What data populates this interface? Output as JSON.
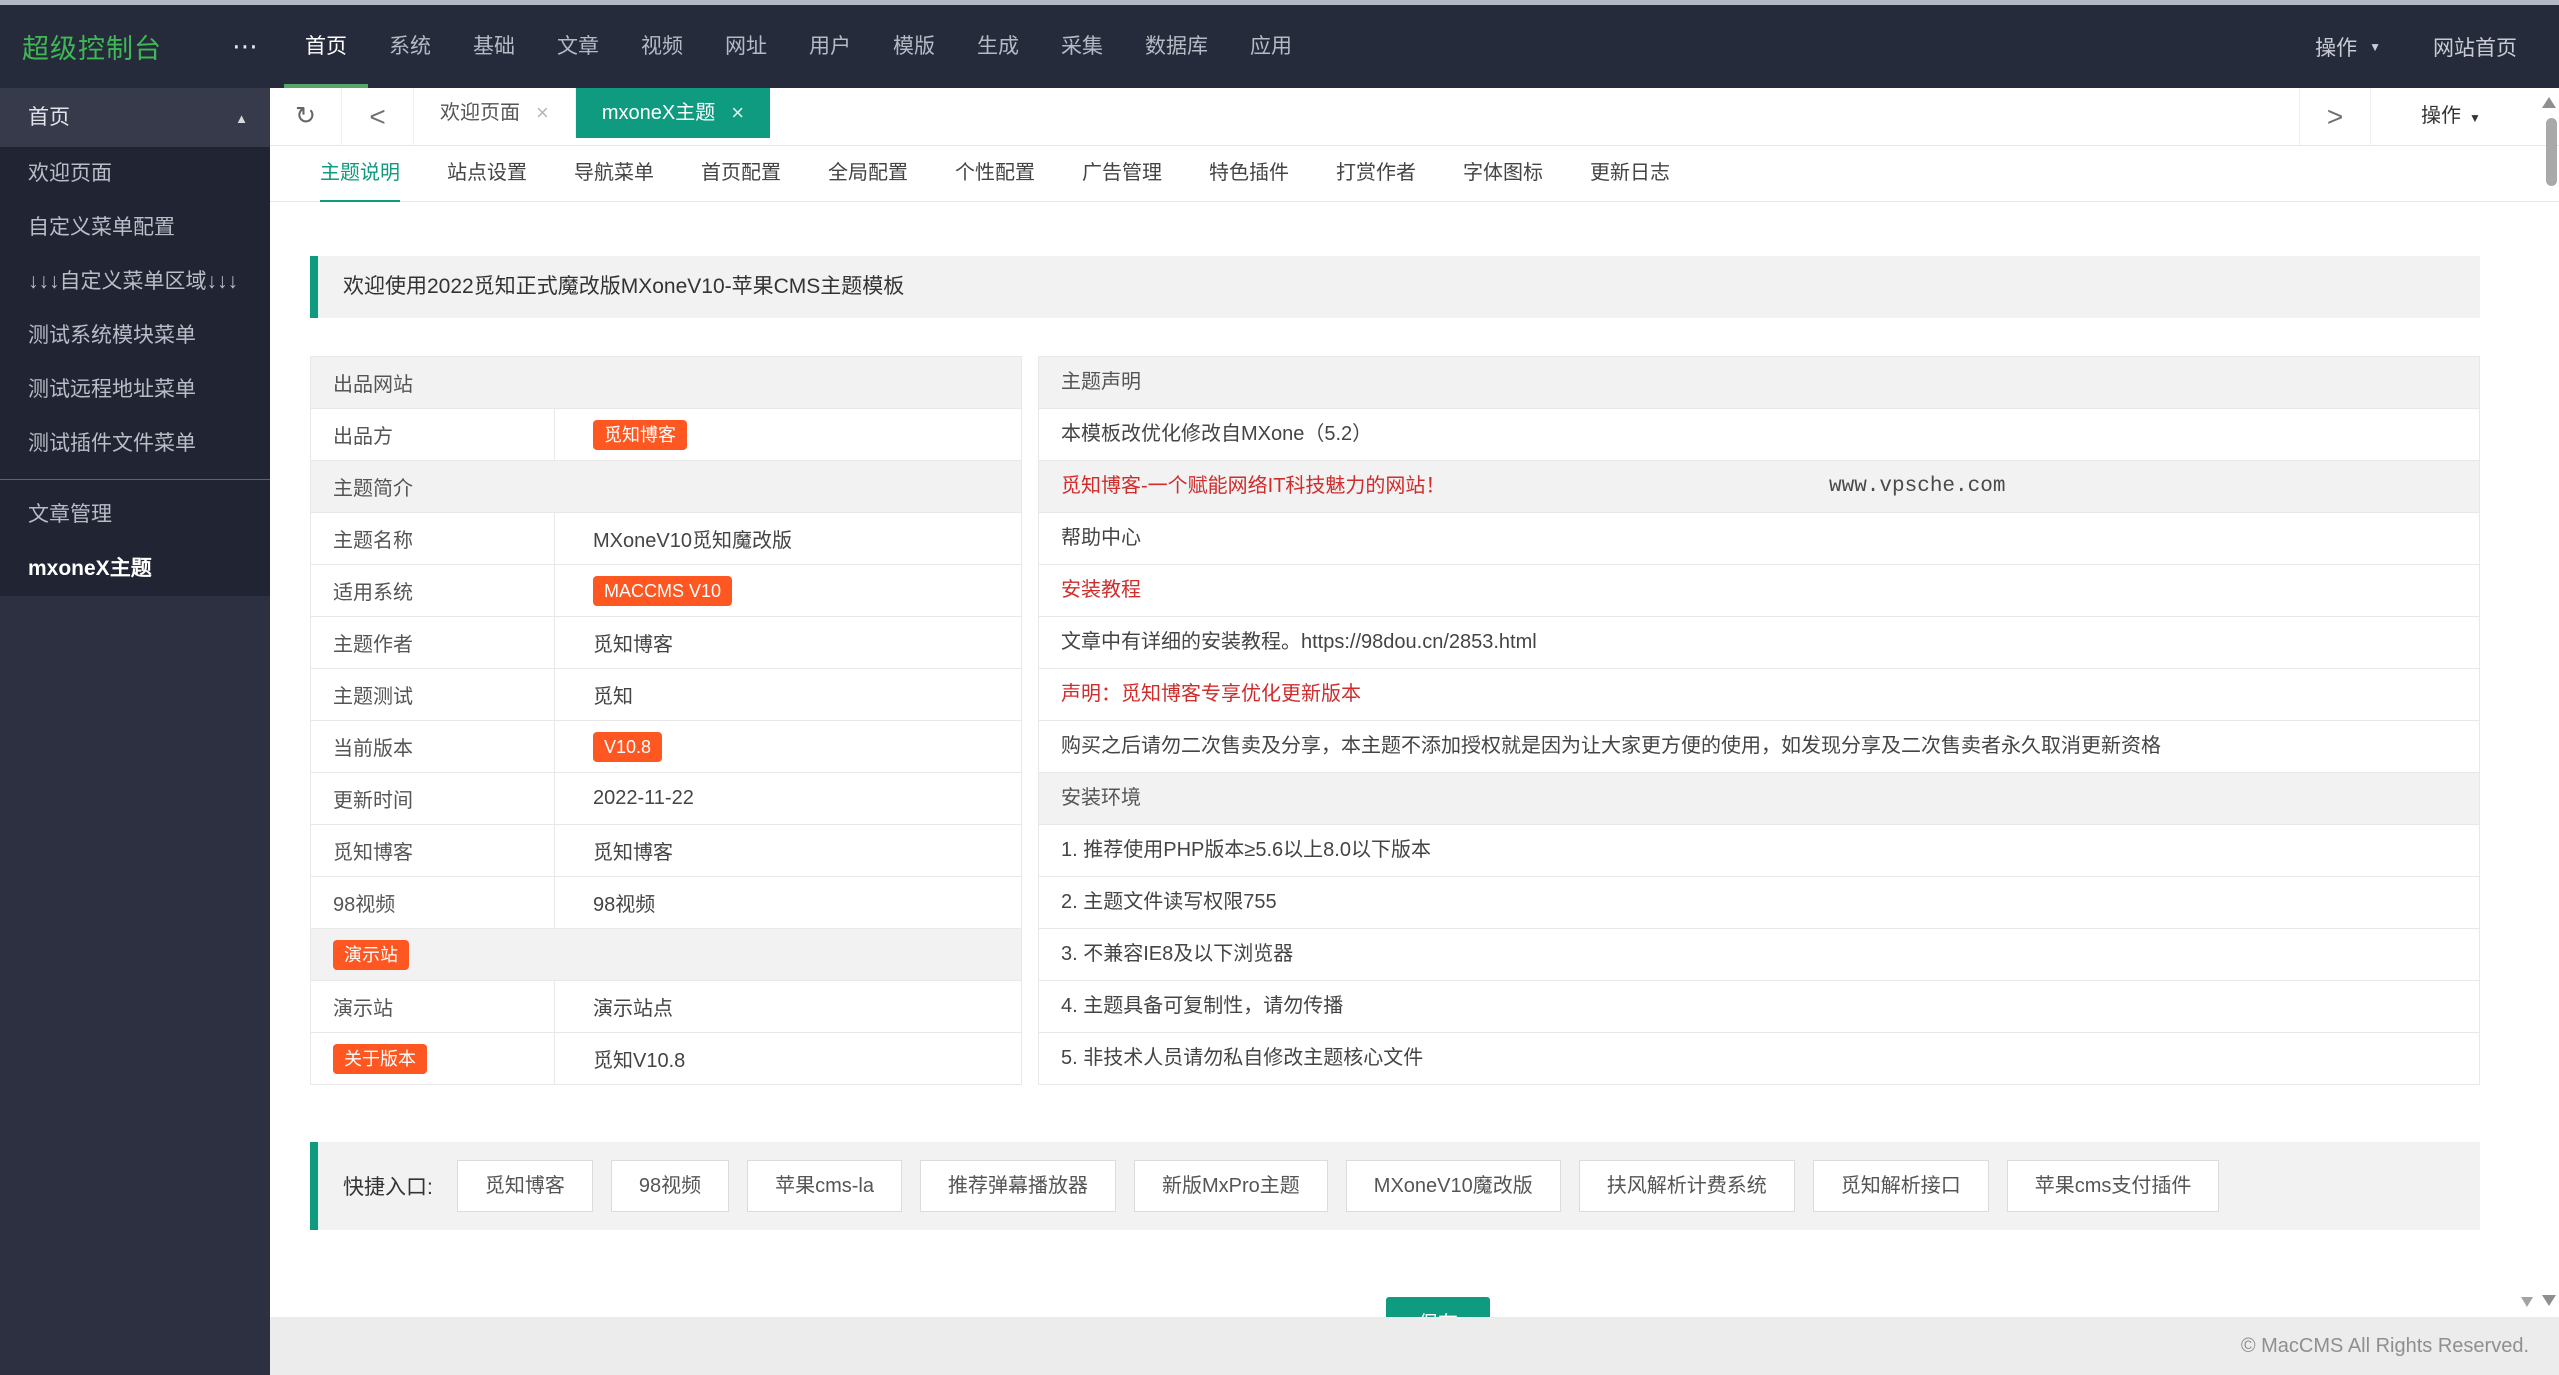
{
  "colors": {
    "accent_green": "#3eb854",
    "accent_teal": "#0f9b80",
    "badge_orange": "#ff5722",
    "alert_red": "#d02c2c",
    "topbar_bg": "#262b3b",
    "sidebar_bg": "#212433"
  },
  "icons": {
    "more": "⋯",
    "refresh": "↻",
    "back": "<",
    "forward": ">",
    "caret_up": "▲",
    "caret_down": "▼",
    "close": "×"
  },
  "topbar": {
    "logo": "超级控制台",
    "menu": [
      "首页",
      "系统",
      "基础",
      "文章",
      "视频",
      "网址",
      "用户",
      "模版",
      "生成",
      "采集",
      "数据库",
      "应用"
    ],
    "active_index": 0,
    "operate_label": "操作",
    "site_home_label": "网站首页"
  },
  "sidebar": {
    "entries": [
      {
        "type": "group",
        "label": "首页"
      },
      {
        "type": "item",
        "label": "欢迎页面"
      },
      {
        "type": "item",
        "label": "自定义菜单配置"
      },
      {
        "type": "item",
        "label": "↓↓↓自定义菜单区域↓↓↓"
      },
      {
        "type": "item",
        "label": "测试系统模块菜单"
      },
      {
        "type": "item",
        "label": "测试远程地址菜单"
      },
      {
        "type": "item",
        "label": "测试插件文件菜单"
      },
      {
        "type": "divider"
      },
      {
        "type": "item",
        "label": "文章管理"
      },
      {
        "type": "active",
        "label": "mxoneX主题"
      }
    ]
  },
  "tabbar": {
    "tabs": [
      {
        "label": "欢迎页面",
        "active": false
      },
      {
        "label": "mxoneX主题",
        "active": true
      }
    ],
    "operate_label": "操作"
  },
  "subtabs": {
    "active_index": 0,
    "items": [
      "主题说明",
      "站点设置",
      "导航菜单",
      "首页配置",
      "全局配置",
      "个性配置",
      "广告管理",
      "特色插件",
      "打赏作者",
      "字体图标",
      "更新日志"
    ]
  },
  "banner": {
    "text": "欢迎使用2022觅知正式魔改版MXoneV10-苹果CMS主题模板"
  },
  "left_table": {
    "rows": [
      {
        "header": true,
        "label": "出品网站"
      },
      {
        "label": "出品方",
        "value_badge": "觅知博客"
      },
      {
        "header": true,
        "label": "主题简介"
      },
      {
        "label": "主题名称",
        "value": "MXoneV10觅知魔改版"
      },
      {
        "label": "适用系统",
        "value_badge": "MACCMS V10"
      },
      {
        "label": "主题作者",
        "value": "觅知博客"
      },
      {
        "label": "主题测试",
        "value": "觅知"
      },
      {
        "label": "当前版本",
        "value_badge": "V10.8"
      },
      {
        "label": "更新时间",
        "value": "2022-11-22"
      },
      {
        "label": "觅知博客",
        "value": "觅知博客"
      },
      {
        "label": "98视频",
        "value": "98视频"
      },
      {
        "header": true,
        "badge": "演示站"
      },
      {
        "label": "演示站",
        "value": "演示站点"
      },
      {
        "label_badge": "关于版本",
        "value": "觅知V10.8"
      }
    ]
  },
  "right_table": {
    "rows": [
      {
        "header": true,
        "text": "主题声明"
      },
      {
        "text": "本模板改优化修改自MXone（5.2）"
      },
      {
        "header": true,
        "red": true,
        "text": "觅知博客-一个赋能网络IT科技魅力的网站！",
        "watermark": "www.vpsche.com"
      },
      {
        "text": "帮助中心"
      },
      {
        "red": true,
        "text": "安装教程"
      },
      {
        "text": "文章中有详细的安装教程。https://98dou.cn/2853.html"
      },
      {
        "red": true,
        "text": "声明：觅知博客专享优化更新版本"
      },
      {
        "text": "购买之后请勿二次售卖及分享，本主题不添加授权就是因为让大家更方便的使用，如发现分享及二次售卖者永久取消更新资格"
      },
      {
        "header": true,
        "text": "安装环境"
      },
      {
        "text": "1. 推荐使用PHP版本≥5.6以上8.0以下版本"
      },
      {
        "text": "2. 主题文件读写权限755"
      },
      {
        "text": "3. 不兼容IE8及以下浏览器"
      },
      {
        "text": "4. 主题具备可复制性，请勿传播"
      },
      {
        "text": "5. 非技术人员请勿私自修改主题核心文件"
      }
    ]
  },
  "quicklinks": {
    "label": "快捷入口:",
    "buttons": [
      "觅知博客",
      "98视频",
      "苹果cms-la",
      "推荐弹幕播放器",
      "新版MxPro主题",
      "MXoneV10魔改版",
      "扶风解析计费系统",
      "觅知解析接口",
      "苹果cms支付插件"
    ]
  },
  "save_button": {
    "label": "保存"
  },
  "footer": {
    "text": "© MacCMS All Rights Reserved."
  }
}
